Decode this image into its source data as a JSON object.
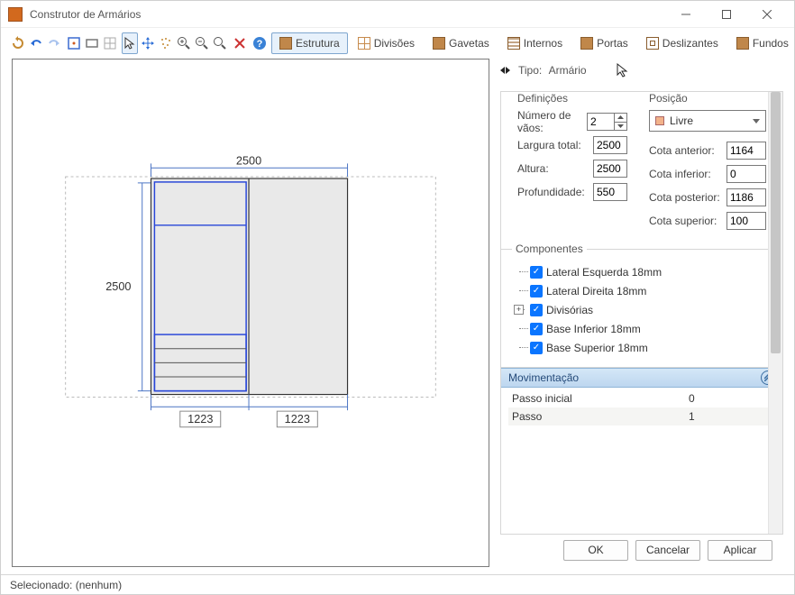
{
  "window": {
    "title": "Construtor de Armários"
  },
  "toolbar_tabs": {
    "estrutura": "Estrutura",
    "divisoes": "Divisões",
    "gavetas": "Gavetas",
    "internos": "Internos",
    "portas": "Portas",
    "deslizantes": "Deslizantes",
    "fundos": "Fundos"
  },
  "type_row": {
    "prefix": "Tipo:",
    "value": "Armário"
  },
  "definicoes": {
    "legend": "Definições",
    "num_vaos_label": "Número de vãos:",
    "num_vaos": "2",
    "largura_label": "Largura total:",
    "largura": "2500",
    "altura_label": "Altura:",
    "altura": "2500",
    "profundidade_label": "Profundidade:",
    "profundidade": "550"
  },
  "posicao": {
    "legend": "Posição",
    "select_value": "Livre",
    "cota_anterior_label": "Cota anterior:",
    "cota_anterior": "1164",
    "cota_inferior_label": "Cota inferior:",
    "cota_inferior": "0",
    "cota_posterior_label": "Cota posterior:",
    "cota_posterior": "1186",
    "cota_superior_label": "Cota superior:",
    "cota_superior": "100"
  },
  "componentes": {
    "legend": "Componentes",
    "items": [
      "Lateral Esquerda 18mm",
      "Lateral Direita 18mm",
      "Divisórias",
      "Base Inferior 18mm",
      "Base Superior 18mm"
    ]
  },
  "movimentacao": {
    "title": "Movimentação",
    "passo_inicial_label": "Passo inicial",
    "passo_inicial": "0",
    "passo_label": "Passo",
    "passo": "1"
  },
  "dimensions": {
    "top_width": "2500",
    "left_height": "2500",
    "bottom_left": "1223",
    "bottom_right": "1223"
  },
  "buttons": {
    "ok": "OK",
    "cancel": "Cancelar",
    "apply": "Aplicar"
  },
  "status": {
    "text": "Selecionado: (nenhum)"
  }
}
